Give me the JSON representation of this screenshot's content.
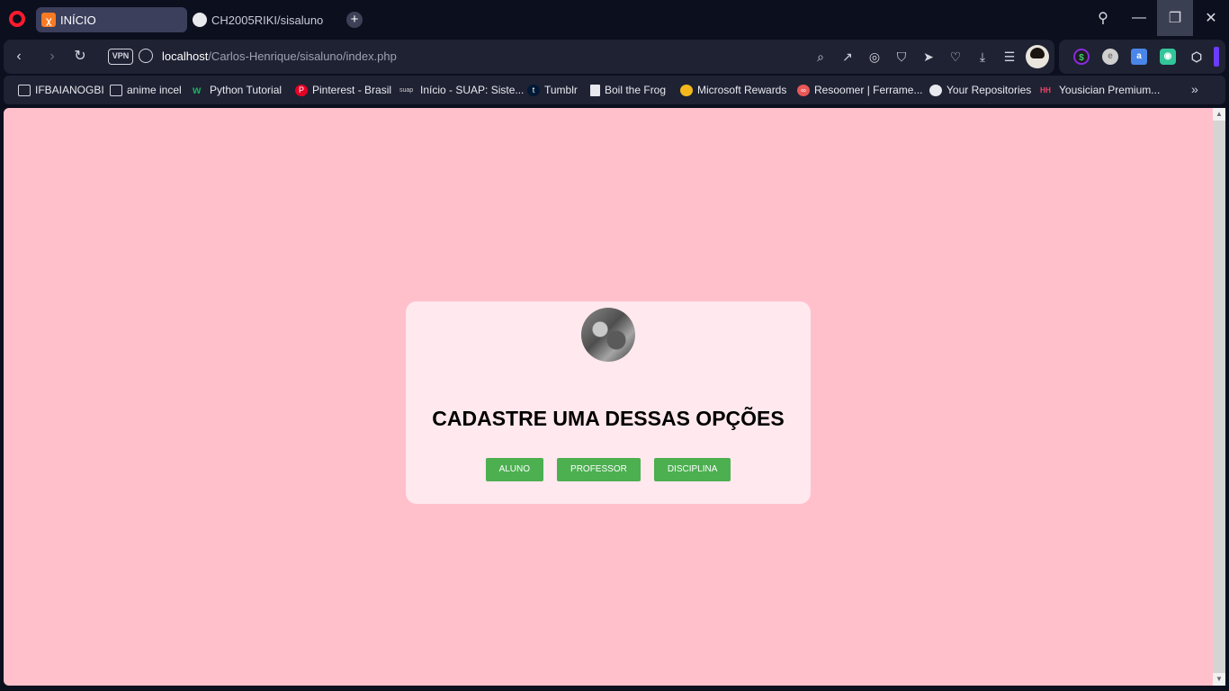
{
  "tabs": [
    {
      "title": "INÍCIO",
      "favicon": "xampp-icon",
      "active": true
    },
    {
      "title": "CH2005RIKI/sisaluno",
      "favicon": "github-icon",
      "active": false
    }
  ],
  "address_bar": {
    "vpn_label": "VPN",
    "url_host": "localhost",
    "url_path": "/Carlos-Henrique/sisaluno/index.php"
  },
  "bookmarks": [
    {
      "label": "IFBAIANOGBI",
      "icon": "folder-icon"
    },
    {
      "label": "anime incel",
      "icon": "folder-icon"
    },
    {
      "label": "Python Tutorial",
      "icon": "w3schools-icon"
    },
    {
      "label": "Pinterest - Brasil",
      "icon": "pinterest-icon"
    },
    {
      "label": "Início - SUAP: Siste...",
      "icon": "suap-icon"
    },
    {
      "label": "Tumblr",
      "icon": "tumblr-icon"
    },
    {
      "label": "Boil the Frog",
      "icon": "document-icon"
    },
    {
      "label": "Microsoft Rewards",
      "icon": "medal-icon"
    },
    {
      "label": "Resoomer | Ferrame...",
      "icon": "resoomer-icon"
    },
    {
      "label": "Your Repositories",
      "icon": "github-icon"
    },
    {
      "label": "Yousician Premium...",
      "icon": "yousician-icon"
    }
  ],
  "page": {
    "title": "CADASTRE UMA DESSAS OPÇÕES",
    "buttons": [
      "ALUNO",
      "PROFESSOR",
      "DISCIPLINA"
    ],
    "button_color": "#4caf50",
    "background_color": "#ffc0cb",
    "card_color": "#ffe8ee"
  }
}
